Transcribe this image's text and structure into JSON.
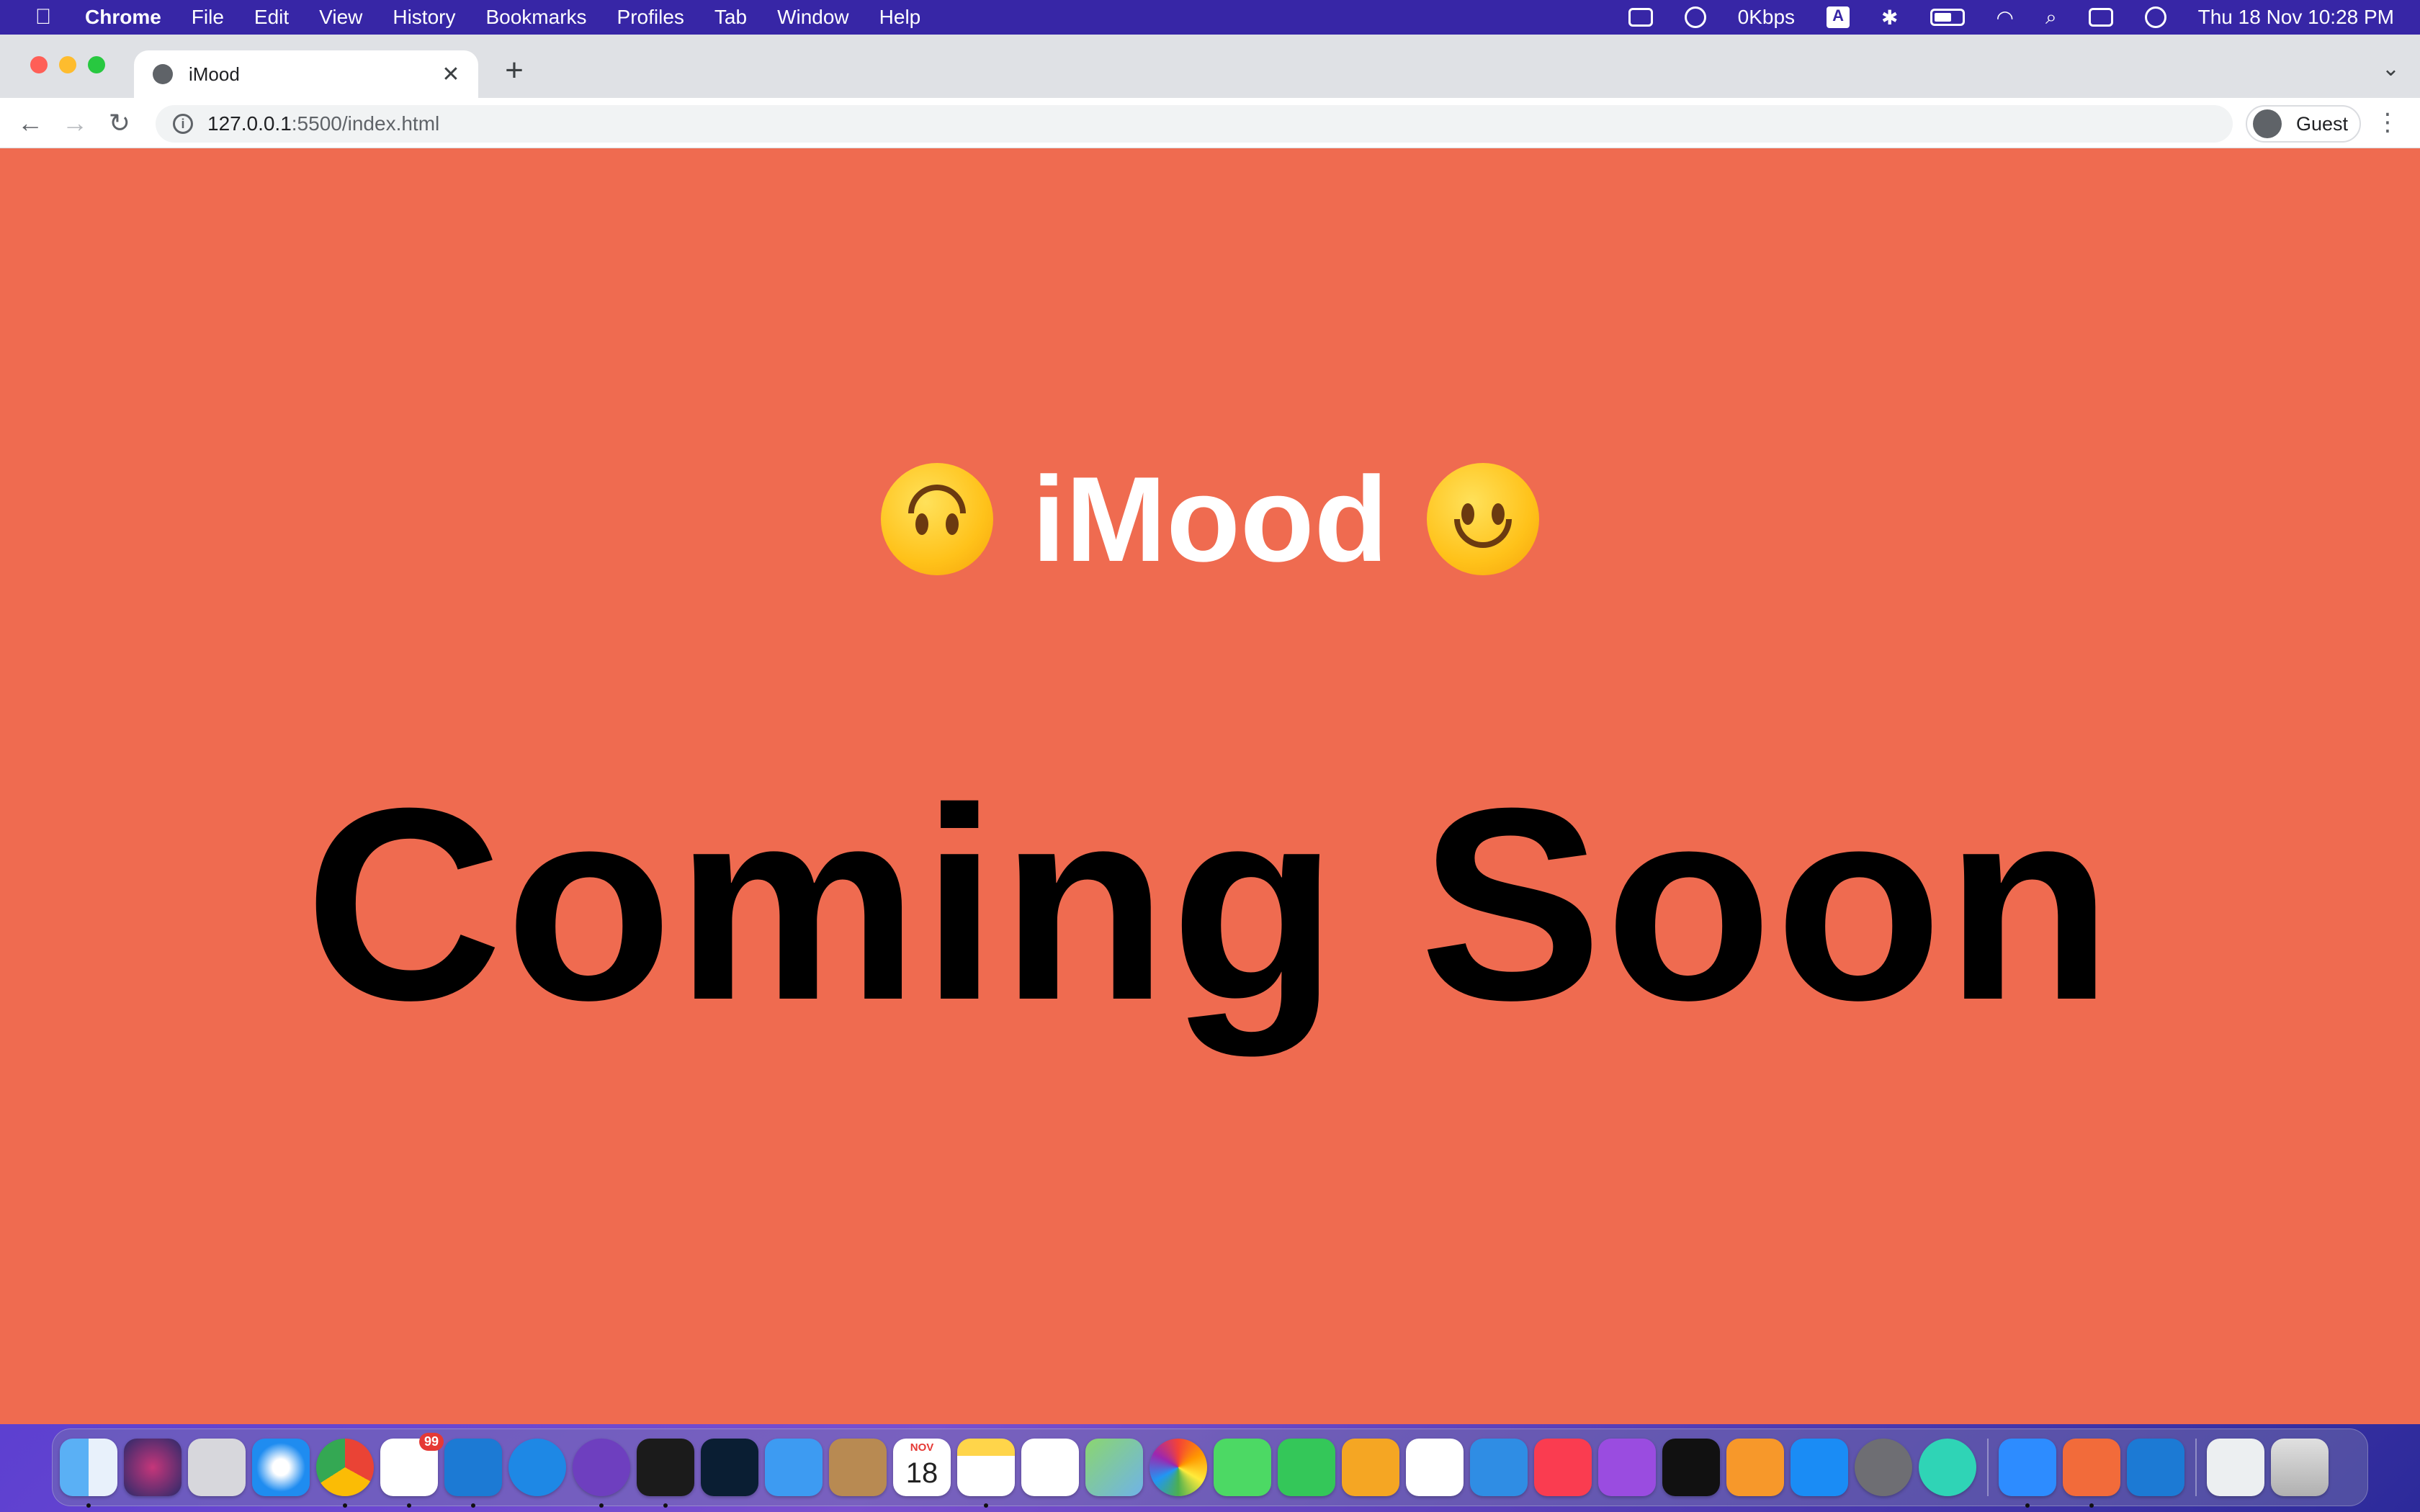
{
  "menubar": {
    "app_name": "Chrome",
    "items": [
      "File",
      "Edit",
      "View",
      "History",
      "Bookmarks",
      "Profiles",
      "Tab",
      "Window",
      "Help"
    ],
    "network_speed": "0Kbps",
    "input_source": "A",
    "datetime": "Thu 18 Nov  10:28 PM"
  },
  "browser": {
    "tab_title": "iMood",
    "url_host": "127.0.0.1",
    "url_path": ":5500/index.html",
    "profile_label": "Guest"
  },
  "page": {
    "title": "iMood",
    "headline": "Coming Soon",
    "background_color": "#ef6b50"
  },
  "dock": {
    "slack_badge": "99",
    "calendar_month": "NOV",
    "calendar_day": "18",
    "apps": [
      "finder-icon",
      "siri-icon",
      "launchpad-icon",
      "safari-icon",
      "chrome-icon",
      "slack-icon",
      "vscode-icon",
      "xcode-instruments-icon",
      "github-desktop-icon",
      "terminal-icon",
      "photoshop-icon",
      "mail-icon",
      "contacts-icon",
      "calendar-icon",
      "notes-icon",
      "reminders-icon",
      "maps-icon",
      "photos-icon",
      "messages-icon",
      "facetime-icon",
      "pages-icon",
      "numbers-icon",
      "keynote-icon",
      "music-icon",
      "podcasts-icon",
      "apple-tv-icon",
      "books-icon",
      "app-store-icon",
      "system-preferences-icon",
      "mind-app-icon",
      "zoom-icon",
      "pen-app-icon",
      "vscode-icon-2",
      "preview-documents-icon",
      "trash-icon"
    ]
  }
}
